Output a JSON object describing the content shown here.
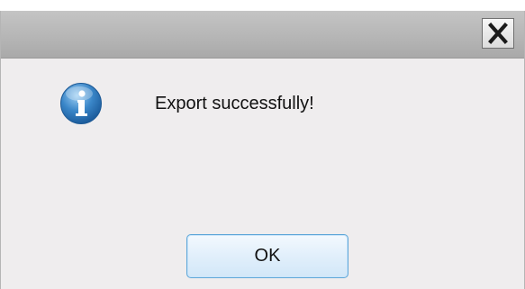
{
  "dialog": {
    "message": "Export successfully!",
    "ok_label": "OK",
    "icon": "info-icon",
    "close_icon": "close-icon"
  },
  "colors": {
    "title_bar": "#b6b6b6",
    "body": "#efedee",
    "ok_border": "#5fa7d8",
    "info_icon": "#3a86c8"
  }
}
